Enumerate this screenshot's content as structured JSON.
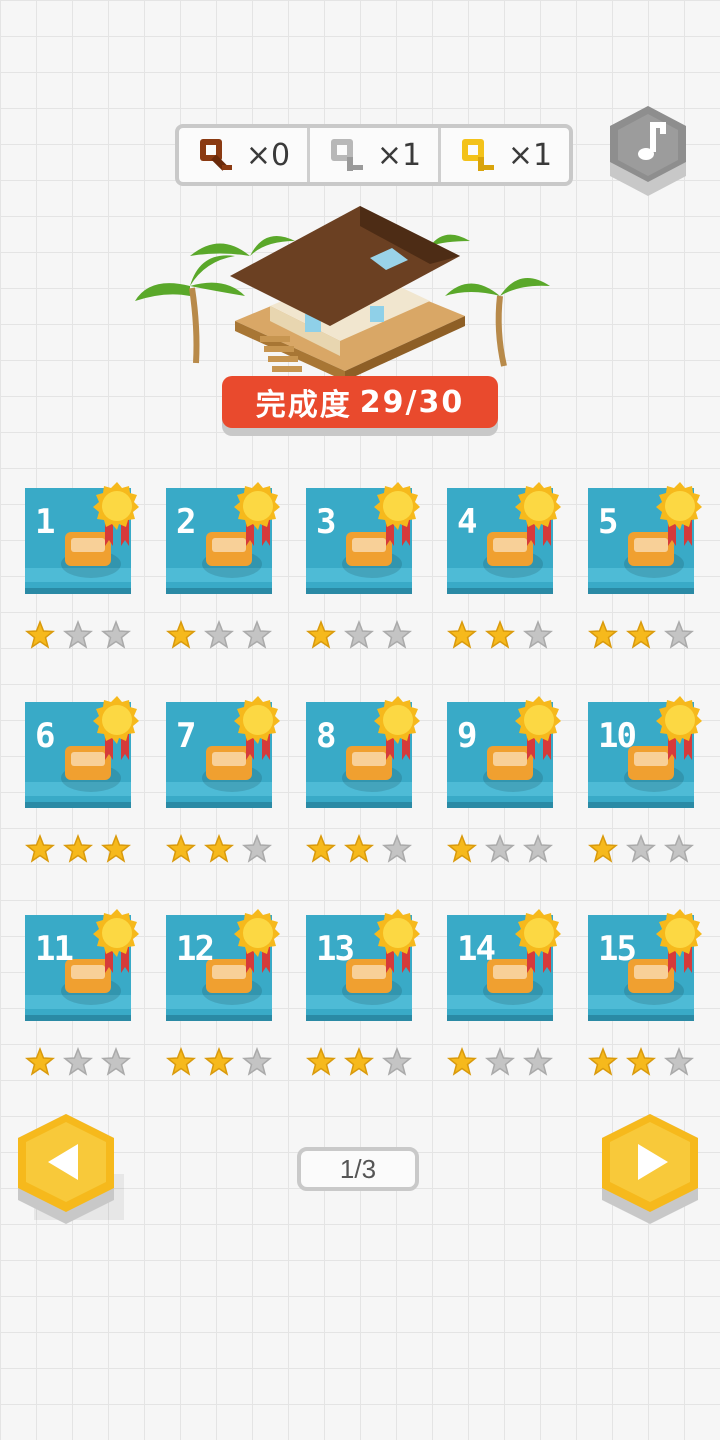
{
  "keys": [
    {
      "icon": "bronze-key-icon",
      "color": "#8a3a12",
      "count": "×0"
    },
    {
      "icon": "silver-key-icon",
      "color": "#b8b8b8",
      "count": "×1"
    },
    {
      "icon": "gold-key-icon",
      "color": "#f3c21a",
      "count": "×1"
    }
  ],
  "music_button": {
    "icon": "music-note-icon"
  },
  "progress": {
    "label": "完成度",
    "value": "29/30"
  },
  "levels": [
    {
      "number": "1",
      "stars": 1,
      "art": "beach-lounger-art"
    },
    {
      "number": "2",
      "stars": 1,
      "art": "hula-dancer-art"
    },
    {
      "number": "3",
      "stars": 1,
      "art": "duck-float-art"
    },
    {
      "number": "4",
      "stars": 2,
      "art": "parrot-cage-art"
    },
    {
      "number": "5",
      "stars": 2,
      "art": "boombox-art"
    },
    {
      "number": "6",
      "stars": 3,
      "art": "pirate-ship-art"
    },
    {
      "number": "7",
      "stars": 2,
      "art": "suitcase-art"
    },
    {
      "number": "8",
      "stars": 2,
      "art": "picnic-table-art"
    },
    {
      "number": "9",
      "stars": 1,
      "art": "crab-art"
    },
    {
      "number": "10",
      "stars": 1,
      "art": "telescope-art"
    },
    {
      "number": "11",
      "stars": 1,
      "art": "speedboat-art"
    },
    {
      "number": "12",
      "stars": 2,
      "art": "barbecue-grill-art"
    },
    {
      "number": "13",
      "stars": 2,
      "art": "sandcastle-art"
    },
    {
      "number": "14",
      "stars": 1,
      "art": "cocktail-glass-art"
    },
    {
      "number": "15",
      "stars": 2,
      "art": "rocking-chair-art"
    }
  ],
  "pager": {
    "text": "1/3"
  },
  "colors": {
    "tile": "#39aac7",
    "accent": "#e94a2d",
    "gold": "#f6b91c",
    "star_off": "#c4c4c4"
  }
}
